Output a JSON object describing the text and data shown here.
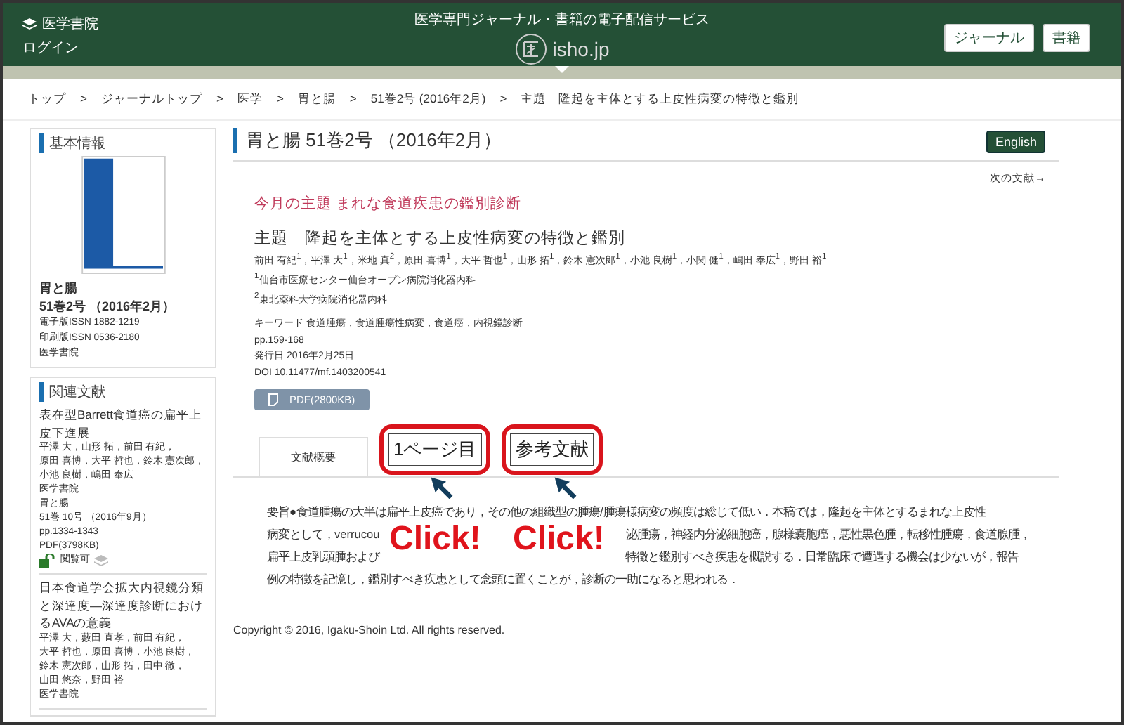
{
  "header": {
    "brand": "医学書院",
    "login": "ログイン",
    "tagline": "医学専門ジャーナル・書籍の電子配信サービス",
    "logo_text": "isho.jp",
    "buttons": [
      "ジャーナル",
      "書籍"
    ]
  },
  "breadcrumb": {
    "separator": ">",
    "items": [
      "トップ",
      "ジャーナルトップ",
      "医学",
      "胃と腸",
      "51巻2号 (2016年2月)",
      "主題　隆起を主体とする上皮性病変の特徴と鑑別"
    ]
  },
  "sidebar": {
    "info": {
      "heading": "基本情報",
      "journal": "胃と腸",
      "issue": "51巻2号 （2016年2月）",
      "lines": [
        "電子版ISSN 1882-1219",
        "印刷版ISSN 0536-2180",
        "医学書院"
      ]
    },
    "related": {
      "heading": "関連文献",
      "items": [
        {
          "title": "表在型Barrett食道癌の扁平上皮下進展",
          "authors": "平澤 大，山形 拓，前田 有紀，原田 喜博，大平 哲也，鈴木 憲次郎，小池 良樹，嶋田 奉広",
          "lines": [
            "医学書院",
            "胃と腸",
            "51巻 10号 （2016年9月）",
            "pp.1334-1343",
            "PDF(3798KB)"
          ],
          "access": "閲覧可"
        },
        {
          "title": "日本食道学会拡大内視鏡分類と深達度―深達度診断におけるAVAの意義",
          "authors": "平澤 大，藪田 直孝，前田 有紀，大平 哲也，原田 喜博，小池 良樹，鈴木 憲次郎，山形 拓，田中 徹，山田 悠奈，野田 裕",
          "lines": [
            "医学書院"
          ]
        }
      ]
    }
  },
  "main": {
    "title": "胃と腸 51巻2号 （2016年2月）",
    "english": "English",
    "next": "次の文献→",
    "series": "今月の主題 まれな食道疾患の鑑別診断",
    "article_title": "主題　隆起を主体とする上皮性病変の特徴と鑑別",
    "authors": "前田 有紀$^{1}$，平澤 大$^{1}$，米地 真$^{2}$，原田 喜博$^{1}$，大平 哲也$^{1}$，山形 拓$^{1}$，鈴木 憲次郎$^{1}$，小池 良樹$^{1}$，小関 健$^{1}$，嶋田 奉広$^{1}$，野田 裕$^{1}$",
    "affiliations": [
      "$^{1}$仙台市医療センター仙台オープン病院消化器内科",
      "$^{2}$東北薬科大学病院消化器内科"
    ],
    "keywords": "キーワード 食道腫瘍，食道腫瘍性病変，食道癌，内視鏡診断",
    "meta": [
      "pp.159-168",
      "発行日 2016年2月25日",
      "DOI 10.11477/mf.1403200541"
    ],
    "pdf": "PDF(2800KB)",
    "tabs": [
      {
        "label": "文献概要",
        "selected": true,
        "highlighted": false
      },
      {
        "label": "1ページ目",
        "selected": false,
        "highlighted": true
      },
      {
        "label": "参考文献",
        "selected": false,
        "highlighted": true
      }
    ],
    "abstract_lines": [
      [
        "要旨●食道腫瘍の大半は扁平上皮癌であり，その他の組織型の腫瘍/腫瘍様病変の頻度は総じて低い．本稿では，隆起を主体とするまれな上皮性"
      ],
      [
        "病変として，verrucou",
        "泌腫瘍，神経内分泌細胞癌，腺様嚢胞癌，悪性黒色腫，転移性腫瘍，食道腺腫，"
      ],
      [
        "扁平上皮乳頭腫および",
        "特徴と鑑別すべき疾患を概説する．日常臨床で遭遇する機会は少ないが，報告"
      ],
      [
        "例の特徴を記憶し，鑑別すべき疾患として念頭に置くことが，診断の一助になると思われる．"
      ]
    ],
    "callouts": [
      "Click!",
      "Click!"
    ],
    "copyright": "Copyright © 2016, Igaku-Shoin Ltd. All rights reserved."
  }
}
